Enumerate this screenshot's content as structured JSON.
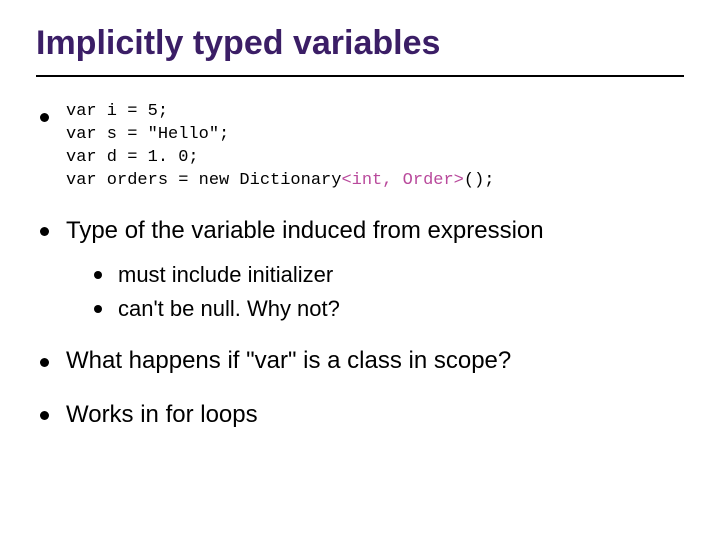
{
  "title": "Implicitly typed variables",
  "code": {
    "l1a": "var i = 5;",
    "l2a": "var s = \"Hello\";",
    "l3a": "var d = 1. 0;",
    "l4a": "var orders = new Dictionary",
    "l4b": "<int, Order>",
    "l4c": "();"
  },
  "bullets": {
    "b2": "Type of the variable induced from expression",
    "b2_1": "must include initializer",
    "b2_2": "can't be null.  Why not?",
    "b3": "What happens if \"var\" is a class in scope?",
    "b4": "Works in for loops"
  }
}
